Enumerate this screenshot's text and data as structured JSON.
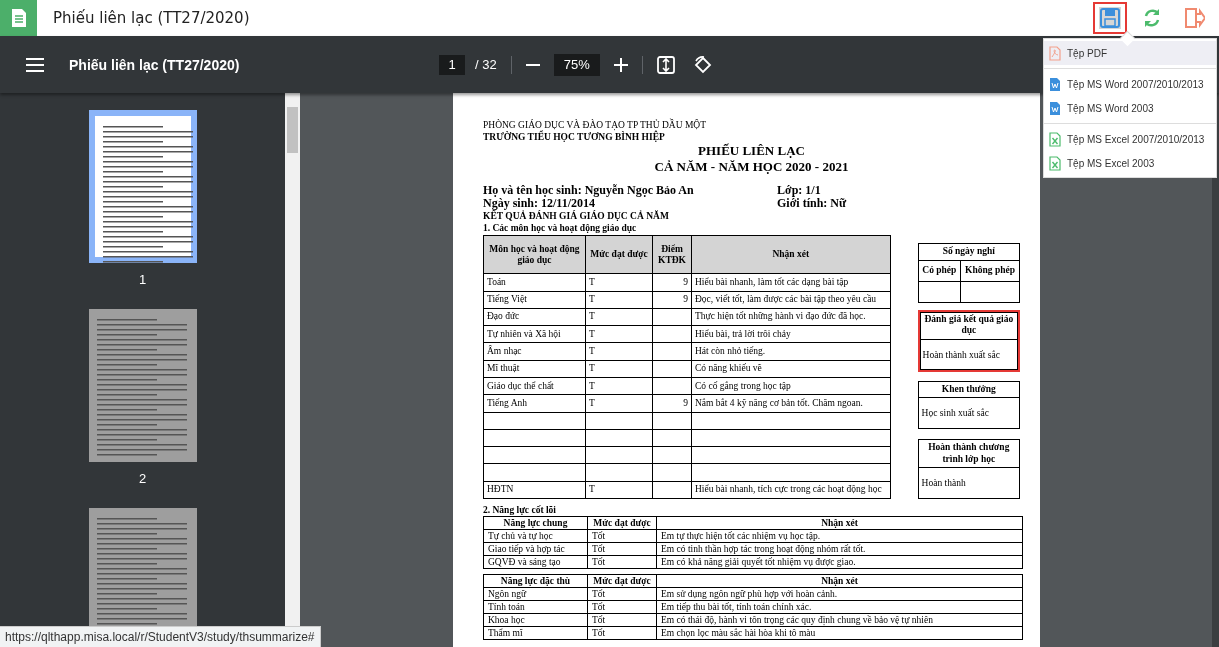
{
  "app_bar": {
    "title": "Phiếu liên lạc (TT27/2020)",
    "actions": [
      {
        "kind": "save",
        "active": true
      },
      {
        "kind": "refresh",
        "active": false
      },
      {
        "kind": "exit",
        "active": false
      }
    ]
  },
  "save_menu": {
    "items": [
      {
        "label": "Tệp PDF",
        "kind": "pdf",
        "selected": true
      },
      {
        "label": "Tệp MS Word 2007/2010/2013",
        "kind": "word",
        "selected": false
      },
      {
        "label": "Tệp MS Word 2003",
        "kind": "word",
        "selected": false
      },
      {
        "label": "Tệp MS Excel 2007/2010/2013",
        "kind": "excel",
        "selected": false
      },
      {
        "label": "Tệp MS Excel 2003",
        "kind": "excel",
        "selected": false
      }
    ]
  },
  "toolbar": {
    "title": "Phiếu liên lạc (TT27/2020)",
    "page": "1",
    "page_total": "/ 32",
    "zoom": "75%"
  },
  "thumbnails": [
    {
      "label": "1",
      "selected": true
    },
    {
      "label": "2",
      "selected": false
    },
    {
      "selected": false
    }
  ],
  "document": {
    "header_lines": [
      {
        "text": "PHÒNG GIÁO DỤC VÀ ĐÀO TẠO TP THỦ DẦU MỘT",
        "bold": false
      },
      {
        "text": "TRƯỜNG TIỂU HỌC TƯƠNG BÌNH HIỆP",
        "bold": true
      }
    ],
    "title_lines": [
      "PHIẾU LIÊN LẠC",
      "CẢ NĂM - NĂM HỌC 2020 - 2021"
    ],
    "info": [
      [
        "Họ và tên học sinh: Nguyễn Ngọc Bảo An",
        "Lớp: 1/1"
      ],
      [
        "Ngày sinh: 12/11/2014",
        "Giới tính: Nữ"
      ]
    ],
    "result_heading": "KẾT QUẢ ĐÁNH GIÁ GIÁO DỤC CẢ NĂM",
    "section_1": {
      "heading": "1. Các môn học và hoạt động giáo dục",
      "columns": [
        "Môn học và hoạt động giáo dục",
        "Mức đạt được",
        "Điểm KTĐK",
        "Nhận xét"
      ],
      "rows": [
        [
          "Toán",
          "T",
          "9",
          "Hiểu bài nhanh, làm tốt các dạng bài tập"
        ],
        [
          "Tiếng Việt",
          "T",
          "9",
          "Đọc, viết tốt, làm được các bài tập theo yêu cầu"
        ],
        [
          "Đạo đức",
          "T",
          null,
          "Thực hiện tốt những hành vi đạo đức đã học."
        ],
        [
          "Tự nhiên và Xã hội",
          "T",
          null,
          "Hiểu bài, trả lời trôi chảy"
        ],
        [
          "Âm nhạc",
          "T",
          null,
          "Hát còn nhỏ tiếng."
        ],
        [
          "Mĩ thuật",
          "T",
          null,
          "Có năng khiếu vẽ"
        ],
        [
          "Giáo dục thể chất",
          "T",
          null,
          "Có cố gắng trong học tập"
        ],
        [
          "Tiếng Anh",
          "T",
          "9",
          "Nắm bắt 4 kỹ năng cơ bản tốt. Chăm ngoan."
        ],
        [],
        [],
        [],
        [],
        [
          "HĐTN",
          "T",
          null,
          "Hiểu bài nhanh, tích cực trong các hoạt động học"
        ]
      ]
    },
    "side_boxes": [
      {
        "kind": "absence",
        "title": "Số ngày nghỉ",
        "columns": [
          "Có phép",
          "Không phép"
        ],
        "highlighted": false
      },
      {
        "kind": "text",
        "title": "Đánh giá kết quả giáo dục",
        "value": "Hoàn thành xuất sắc",
        "highlighted": true
      },
      {
        "kind": "text",
        "title": "Khen thưởng",
        "value": "Học sinh xuất sắc",
        "highlighted": false
      },
      {
        "kind": "text",
        "title": "Hoàn thành chương trình lớp học",
        "value": "Hoàn thành",
        "highlighted": false
      }
    ],
    "section_2": {
      "heading": "2. Năng lực cốt lõi",
      "tables": [
        {
          "columns": [
            "Năng lực chung",
            "Mức đạt được",
            "Nhận xét"
          ],
          "rows": [
            [
              "Tự chủ và tự học",
              "Tốt",
              "Em tự thực hiện tốt các nhiệm vụ học tập."
            ],
            [
              "Giao tiếp và hợp tác",
              "Tốt",
              "Em có tinh thần hợp tác trong hoạt động nhóm rất tốt."
            ],
            [
              "GQVĐ và sáng tạo",
              "Tốt",
              "Em có khả năng giải quyết tốt nhiệm vụ được giao."
            ]
          ]
        },
        {
          "columns": [
            "Năng lực đặc thù",
            "Mức đạt được",
            "Nhận xét"
          ],
          "rows": [
            [
              "Ngôn ngữ",
              "Tốt",
              "Em sử dụng ngôn ngữ phù hợp với hoàn cảnh."
            ],
            [
              "Tính toán",
              "Tốt",
              "Em tiếp thu bài tốt, tính toán chính xác."
            ],
            [
              "Khoa học",
              "Tốt",
              "Em có thái độ, hành vi tôn trọng các quy định chung về bảo vệ tự nhiên"
            ],
            [
              "Thẩm mĩ",
              "Tốt",
              "Em chọn lọc màu sắc hài hòa khi tô màu"
            ]
          ]
        }
      ]
    }
  },
  "status_url": "https://qlthapp.misa.local/r/StudentV3/study/thsummarize#"
}
